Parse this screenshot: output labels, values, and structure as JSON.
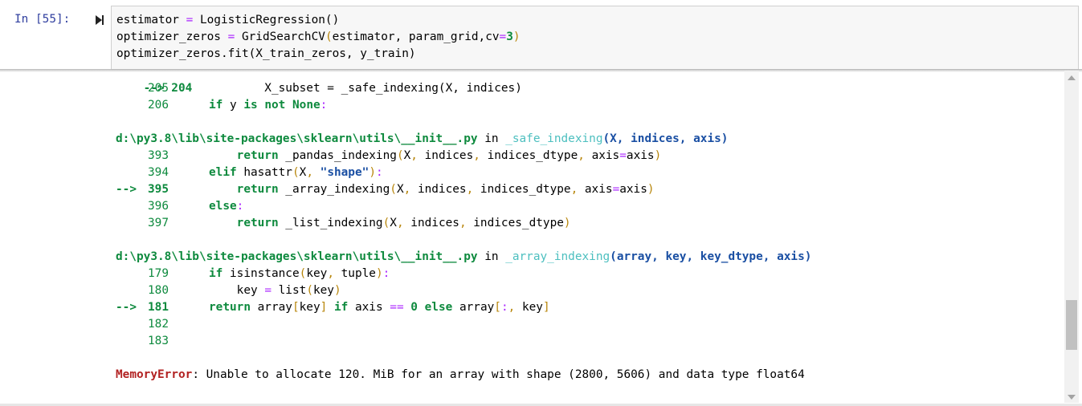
{
  "cell": {
    "prompt": "In [55]:",
    "code": [
      {
        "t": [
          [
            "estimator ",
            ""
          ],
          [
            "=",
            "op"
          ],
          [
            " LogisticRegression()",
            ""
          ]
        ]
      },
      {
        "t": [
          [
            "optimizer_zeros ",
            ""
          ],
          [
            "=",
            "op"
          ],
          [
            " GridSearchCV",
            ""
          ],
          [
            "(",
            "paren"
          ],
          [
            "estimator, param_grid,cv",
            ""
          ],
          [
            "=",
            "op"
          ],
          [
            "3",
            "zero"
          ],
          [
            ")",
            "paren"
          ]
        ]
      },
      {
        "t": [
          [
            "optimizer_zeros.fit(X_train_zeros, y_train)",
            ""
          ]
        ]
      }
    ]
  },
  "output": {
    "partial_line": {
      "prefix": "--> 204",
      "code": "        X_subset = _safe_indexing(X, indices)"
    },
    "blocks": [
      {
        "type": "lines",
        "lines": [
          {
            "num": "205",
            "parts": []
          },
          {
            "num": "206",
            "parts": [
              [
                "if",
                "kw"
              ],
              [
                " y ",
                ""
              ],
              [
                "is",
                "kw"
              ],
              [
                " ",
                ""
              ],
              [
                "not",
                "kw"
              ],
              [
                " ",
                ""
              ],
              [
                "None",
                "kw"
              ],
              [
                ":",
                "op"
              ]
            ]
          }
        ]
      },
      {
        "type": "header",
        "path": "d:\\py3.8\\lib\\site-packages\\sklearn\\utils\\__init__.py",
        "in": " in ",
        "func": "_safe_indexing",
        "args": "(X, indices, axis)"
      },
      {
        "type": "lines",
        "lines": [
          {
            "num": "393",
            "parts": [
              [
                "    ",
                "ind"
              ],
              [
                "return",
                "kw"
              ],
              [
                " _pandas_indexing",
                ""
              ],
              [
                "(",
                "paren"
              ],
              [
                "X",
                ""
              ],
              [
                ",",
                "paren"
              ],
              [
                " indices",
                ""
              ],
              [
                ",",
                "paren"
              ],
              [
                " indices_dtype",
                ""
              ],
              [
                ",",
                "paren"
              ],
              [
                " axis",
                ""
              ],
              [
                "=",
                "op"
              ],
              [
                "axis",
                ""
              ],
              [
                ")",
                "paren"
              ]
            ]
          },
          {
            "num": "394",
            "parts": [
              [
                "elif",
                "kw"
              ],
              [
                " hasattr",
                ""
              ],
              [
                "(",
                "paren"
              ],
              [
                "X",
                ""
              ],
              [
                ",",
                "paren"
              ],
              [
                " ",
                ""
              ],
              [
                "\"shape\"",
                "str"
              ],
              [
                ")",
                "paren"
              ],
              [
                ":",
                "op"
              ]
            ]
          },
          {
            "num": "395",
            "arrow": "-->",
            "parts": [
              [
                "    ",
                "ind"
              ],
              [
                "return",
                "kw"
              ],
              [
                " _array_indexing",
                ""
              ],
              [
                "(",
                "paren"
              ],
              [
                "X",
                ""
              ],
              [
                ",",
                "paren"
              ],
              [
                " indices",
                ""
              ],
              [
                ",",
                "paren"
              ],
              [
                " indices_dtype",
                ""
              ],
              [
                ",",
                "paren"
              ],
              [
                " axis",
                ""
              ],
              [
                "=",
                "op"
              ],
              [
                "axis",
                ""
              ],
              [
                ")",
                "paren"
              ]
            ]
          },
          {
            "num": "396",
            "parts": [
              [
                "else",
                "kw"
              ],
              [
                ":",
                "op"
              ]
            ]
          },
          {
            "num": "397",
            "parts": [
              [
                "    ",
                "ind"
              ],
              [
                "return",
                "kw"
              ],
              [
                " _list_indexing",
                ""
              ],
              [
                "(",
                "paren"
              ],
              [
                "X",
                ""
              ],
              [
                ",",
                "paren"
              ],
              [
                " indices",
                ""
              ],
              [
                ",",
                "paren"
              ],
              [
                " indices_dtype",
                ""
              ],
              [
                ")",
                "paren"
              ]
            ]
          }
        ]
      },
      {
        "type": "header",
        "path": "d:\\py3.8\\lib\\site-packages\\sklearn\\utils\\__init__.py",
        "in": " in ",
        "func": "_array_indexing",
        "args": "(array, key, key_dtype, axis)"
      },
      {
        "type": "lines",
        "lines": [
          {
            "num": "179",
            "parts": [
              [
                "if",
                "kw"
              ],
              [
                " isinstance",
                ""
              ],
              [
                "(",
                "paren"
              ],
              [
                "key",
                ""
              ],
              [
                ",",
                "paren"
              ],
              [
                " tuple",
                ""
              ],
              [
                ")",
                "paren"
              ],
              [
                ":",
                "op"
              ]
            ]
          },
          {
            "num": "180",
            "parts": [
              [
                "    ",
                "ind"
              ],
              [
                "key ",
                ""
              ],
              [
                "=",
                "op"
              ],
              [
                " list",
                ""
              ],
              [
                "(",
                "paren"
              ],
              [
                "key",
                ""
              ],
              [
                ")",
                "paren"
              ]
            ]
          },
          {
            "num": "181",
            "arrow": "-->",
            "parts": [
              [
                "return",
                "kw"
              ],
              [
                " array",
                ""
              ],
              [
                "[",
                "paren"
              ],
              [
                "key",
                ""
              ],
              [
                "]",
                "paren"
              ],
              [
                " ",
                ""
              ],
              [
                "if",
                "kw"
              ],
              [
                " axis ",
                ""
              ],
              [
                "==",
                "op"
              ],
              [
                " ",
                ""
              ],
              [
                "0",
                "zero"
              ],
              [
                " ",
                ""
              ],
              [
                "else",
                "kw"
              ],
              [
                " array",
                ""
              ],
              [
                "[",
                "paren"
              ],
              [
                ":",
                "op"
              ],
              [
                ",",
                "paren"
              ],
              [
                " key",
                ""
              ],
              [
                "]",
                "paren"
              ]
            ]
          },
          {
            "num": "182",
            "parts": []
          },
          {
            "num": "183",
            "parts": []
          }
        ]
      },
      {
        "type": "error",
        "name": "MemoryError",
        "message": ": Unable to allocate 120. MiB for an array with shape (2800, 5606) and data type float64"
      }
    ]
  },
  "scrollbar": {
    "position": 0.83
  }
}
